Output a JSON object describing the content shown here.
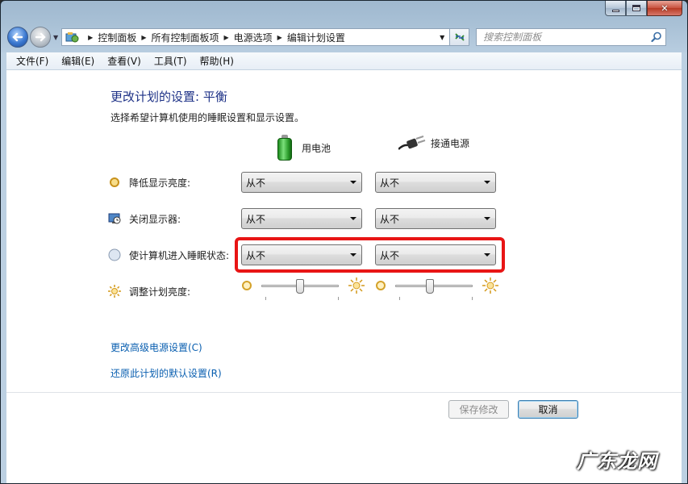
{
  "window": {
    "controls": {
      "minimize_icon": "minimize-icon",
      "maximize_icon": "maximize-icon",
      "close_glyph": "✕"
    }
  },
  "nav": {
    "breadcrumbs": [
      "控制面板",
      "所有控制面板项",
      "电源选项",
      "编辑计划设置"
    ],
    "search_placeholder": "搜索控制面板"
  },
  "menu": [
    "文件(F)",
    "编辑(E)",
    "查看(V)",
    "工具(T)",
    "帮助(H)"
  ],
  "page": {
    "title": "更改计划的设置: 平衡",
    "subtitle": "选择希望计算机使用的睡眠设置和显示设置。"
  },
  "columns": {
    "battery": "用电池",
    "plugged": "接通电源"
  },
  "settings": [
    {
      "label": "降低显示亮度:",
      "battery": "从不",
      "plugged": "从不"
    },
    {
      "label": "关闭显示器:",
      "battery": "从不",
      "plugged": "从不"
    },
    {
      "label": "使计算机进入睡眠状态:",
      "battery": "从不",
      "plugged": "从不"
    }
  ],
  "brightness": {
    "label": "调整计划亮度:",
    "battery_level": 0.5,
    "plugged_level": 0.45
  },
  "links": {
    "advanced": "更改高级电源设置(C)",
    "restore": "还原此计划的默认设置(R)"
  },
  "buttons": {
    "save": "保存修改",
    "cancel": "取消"
  },
  "watermark": "广东龙网",
  "colors": {
    "title_blue": "#1e3287",
    "link_blue": "#0a5fb0",
    "highlight_red": "#e81515"
  }
}
